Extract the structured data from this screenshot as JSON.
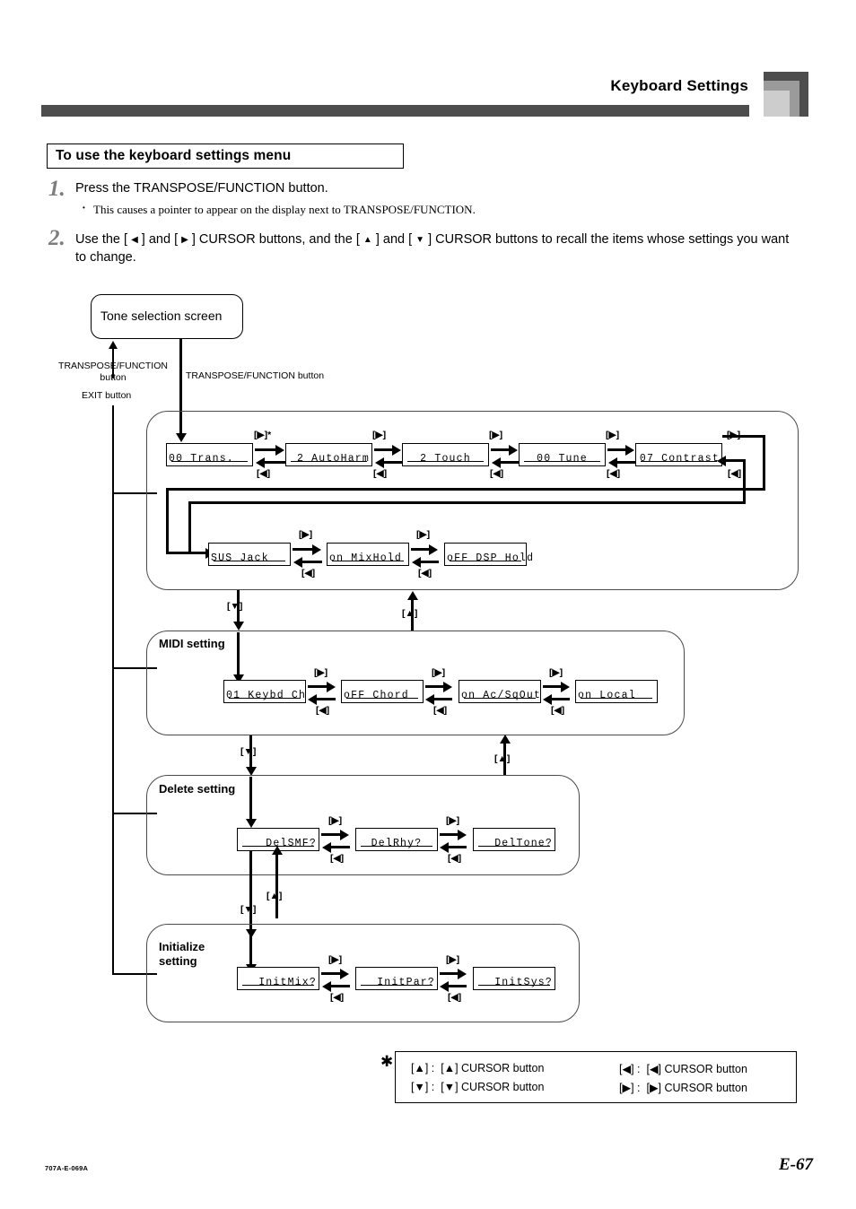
{
  "header": {
    "title": "Keyboard Settings"
  },
  "section": {
    "title": "To use the keyboard settings menu"
  },
  "steps": [
    {
      "number": "1.",
      "text": "Press the TRANSPOSE/FUNCTION button.",
      "bullet_glyph": "•",
      "bullet": "This causes a pointer to appear on the display next to TRANSPOSE/FUNCTION."
    },
    {
      "number": "2.",
      "text_part1": "Use the [ ",
      "text_part2": " ] and [ ",
      "text_part3": " ] CURSOR buttons, and the [ ",
      "text_part4": " ] and [ ",
      "text_part5": " ] CURSOR buttons to recall the items whose settings you want to change."
    }
  ],
  "diagram": {
    "tone_screen": "Tone selection screen",
    "label_transpose_function_button": "TRANSPOSE/FUNCTION\nbutton",
    "label_exit_button": "EXIT button",
    "label_transpose_function_button_right": "TRANSPOSE/FUNCTION button",
    "key_right": "[▶]",
    "key_left": "[◀]",
    "key_up": "[▲]",
    "key_down": "[▼]",
    "key_right_star": "[▶]*",
    "panels": [
      {
        "name": "function-setting",
        "title": "",
        "rows": [
          {
            "items": [
              {
                "prefix": "00",
                "label": "Trans."
              },
              {
                "prefix": "2",
                "label": "AutoHarm"
              },
              {
                "prefix": "2",
                "label": "Touch"
              },
              {
                "prefix": "00",
                "label": "Tune"
              },
              {
                "prefix": "07",
                "label": "Contrast"
              }
            ]
          },
          {
            "items": [
              {
                "prefix": "SUS",
                "label": "Jack"
              },
              {
                "prefix": "on",
                "label": "MixHold"
              },
              {
                "prefix": "oFF",
                "label": "DSP Hold"
              }
            ]
          }
        ]
      },
      {
        "name": "midi-setting",
        "title": "MIDI setting",
        "rows": [
          {
            "items": [
              {
                "prefix": "01",
                "label": "Keybd Ch"
              },
              {
                "prefix": "oFF",
                "label": "Chord"
              },
              {
                "prefix": "on",
                "label": "Ac/SqOut"
              },
              {
                "prefix": "on",
                "label": "Local"
              }
            ]
          }
        ]
      },
      {
        "name": "delete-setting",
        "title": "Delete setting",
        "rows": [
          {
            "items": [
              {
                "prefix": "",
                "label": "DelSMF?"
              },
              {
                "prefix": "",
                "label": "DelRhy?"
              },
              {
                "prefix": "",
                "label": "DelTone?"
              }
            ]
          }
        ]
      },
      {
        "name": "initialize-setting",
        "title": "Initialize\nsetting",
        "rows": [
          {
            "items": [
              {
                "prefix": "",
                "label": "InitMix?"
              },
              {
                "prefix": "",
                "label": "InitPar?"
              },
              {
                "prefix": "",
                "label": "InitSys?"
              }
            ]
          }
        ]
      }
    ]
  },
  "legend": {
    "star": "✳",
    "entries": [
      {
        "key": "[▲] :",
        "desc": "[▲] CURSOR button"
      },
      {
        "key": "[▼] :",
        "desc": "[▼] CURSOR button"
      },
      {
        "key": "[◀] :",
        "desc": "[◀] CURSOR button"
      },
      {
        "key": "[▶] :",
        "desc": "[▶] CURSOR button"
      }
    ]
  },
  "footer": {
    "code": "707A-E-069A",
    "page": "E-67"
  },
  "lcd_labels": {
    "trans": "00 Trans.",
    "autoharm": "2 AutoHarm",
    "touch": "2 Touch",
    "tune": "00 Tune",
    "contrast": "07 Contrast",
    "susjack": "SUS Jack",
    "mixhold": "on  MixHold",
    "dsphold": "oFF DSP Hold",
    "keybdch": "01 Keybd Ch",
    "chord": "oFF Chord",
    "acsqout": "on  Ac/SqOut",
    "local": "on  Local",
    "delsmf": "DelSMF?",
    "delrhy": "DelRhy?",
    "deltone": "DelTone?",
    "initmix": "InitMix?",
    "initpar": "InitPar?",
    "initsys": "InitSys?"
  }
}
